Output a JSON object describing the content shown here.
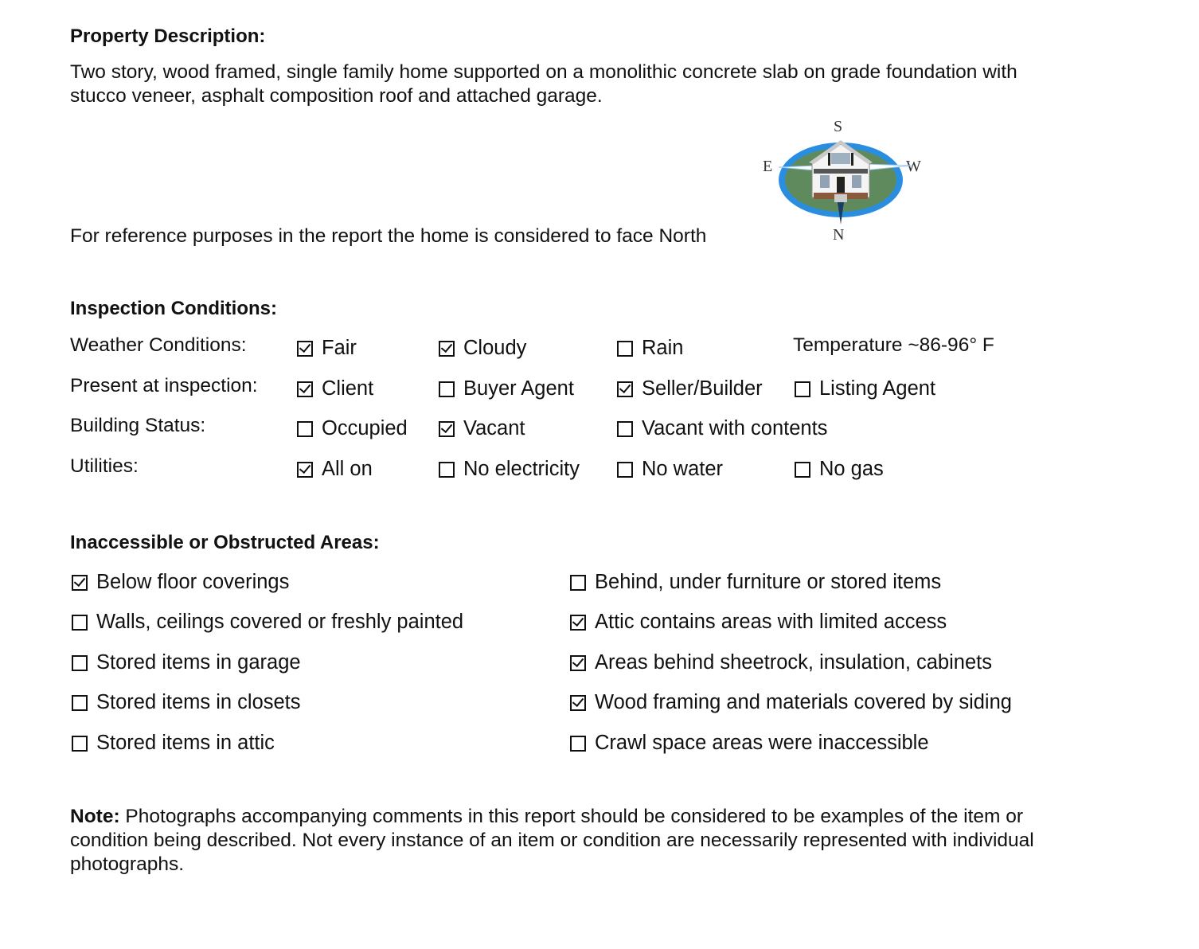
{
  "property": {
    "heading": "Property Description:",
    "description_line1": "Two story, wood framed, single family home supported on a monolithic concrete slab on grade foundation with",
    "description_line2": "stucco veneer, asphalt composition roof and attached garage.",
    "orientation_note": "For reference purposes in the report the home is considered to face North",
    "compass": {
      "icon": "house-compass-icon",
      "south": "S",
      "east": "E",
      "west": "W",
      "north": "N",
      "colors": {
        "ring": "#2a8ee0",
        "ground": "#5f8a5e"
      }
    }
  },
  "inspection": {
    "heading": "Inspection Conditions:",
    "rows": [
      {
        "label": "Weather Conditions:",
        "options": [
          {
            "text": "Fair",
            "checked": true
          },
          {
            "text": "Cloudy",
            "checked": true
          },
          {
            "text": "Rain",
            "checked": false
          }
        ],
        "extra": "Temperature ~86-96° F"
      },
      {
        "label": "Present at inspection:",
        "options": [
          {
            "text": "Client",
            "checked": true
          },
          {
            "text": "Buyer Agent",
            "checked": false
          },
          {
            "text": "Seller/Builder",
            "checked": true
          },
          {
            "text": "Listing Agent",
            "checked": false
          }
        ]
      },
      {
        "label": "Building Status:",
        "options": [
          {
            "text": "Occupied",
            "checked": false
          },
          {
            "text": "Vacant",
            "checked": true
          },
          {
            "text": "Vacant with contents",
            "checked": false
          }
        ]
      },
      {
        "label": "Utilities:",
        "options": [
          {
            "text": "All on",
            "checked": true
          },
          {
            "text": "No electricity",
            "checked": false
          },
          {
            "text": "No water",
            "checked": false
          },
          {
            "text": "No gas",
            "checked": false
          }
        ]
      }
    ]
  },
  "inaccessible": {
    "heading": "Inaccessible or Obstructed Areas:",
    "left": [
      {
        "text": "Below floor coverings",
        "checked": true
      },
      {
        "text": "Walls, ceilings covered or freshly painted",
        "checked": false
      },
      {
        "text": "Stored items in garage",
        "checked": false
      },
      {
        "text": "Stored items in closets",
        "checked": false
      },
      {
        "text": "Stored items in attic",
        "checked": false
      }
    ],
    "right": [
      {
        "text": "Behind, under furniture or stored items",
        "checked": false
      },
      {
        "text": "Attic contains areas with limited access",
        "checked": true
      },
      {
        "text": "Areas behind sheetrock, insulation, cabinets",
        "checked": true
      },
      {
        "text": "Wood framing and materials covered by siding",
        "checked": true
      },
      {
        "text": "Crawl space areas were inaccessible",
        "checked": false
      }
    ]
  },
  "note": {
    "label": "Note:",
    "line1": " Photographs accompanying comments in this report should be considered to be examples of the item or",
    "line2": "condition being described. Not every instance of an item or condition are necessarily represented with individual",
    "line3": "photographs."
  }
}
